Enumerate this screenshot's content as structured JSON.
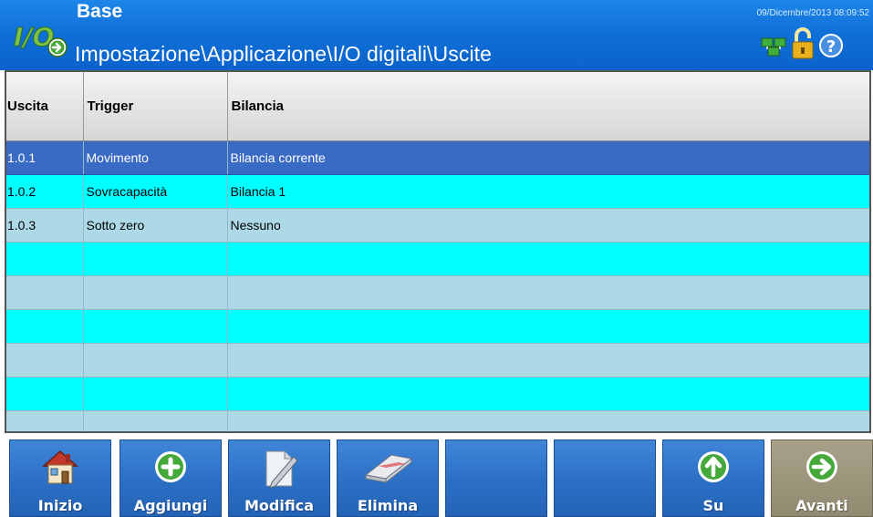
{
  "header": {
    "title": "Base",
    "breadcrumb": "Impostazione\\Applicazione\\I/O digitali\\Uscite",
    "datetime": "09/Dicembre/2013 08:09:52",
    "logo_icon": "io-logo-icon",
    "status_icons": [
      "network-icon",
      "unlocked-padlock-icon",
      "help-icon"
    ]
  },
  "table": {
    "columns": [
      "Uscita",
      "Trigger",
      "Bilancia"
    ],
    "rows": [
      [
        "1.0.1",
        "Movimento",
        "Bilancia corrente"
      ],
      [
        "1.0.2",
        "Sovracapacità",
        "Bilancia 1"
      ],
      [
        "1.0.3",
        "Sotto zero",
        "Nessuno"
      ],
      [
        "",
        "",
        ""
      ],
      [
        "",
        "",
        ""
      ],
      [
        "",
        "",
        ""
      ],
      [
        "",
        "",
        ""
      ],
      [
        "",
        "",
        ""
      ],
      [
        "",
        "",
        ""
      ]
    ],
    "selected_row": 0
  },
  "toolbar": {
    "home": "Inizio",
    "add": "Aggiungi",
    "edit": "Modifica",
    "delete": "Elimina",
    "up": "Su",
    "next": "Avanti"
  },
  "colors": {
    "header_blue": "#0f6fd8",
    "row_cyan": "#00ffff",
    "row_lightblue": "#add8e6",
    "row_selected": "#3a6bc4",
    "button_blue": "#2b6fc5",
    "button_next": "#918a70"
  }
}
